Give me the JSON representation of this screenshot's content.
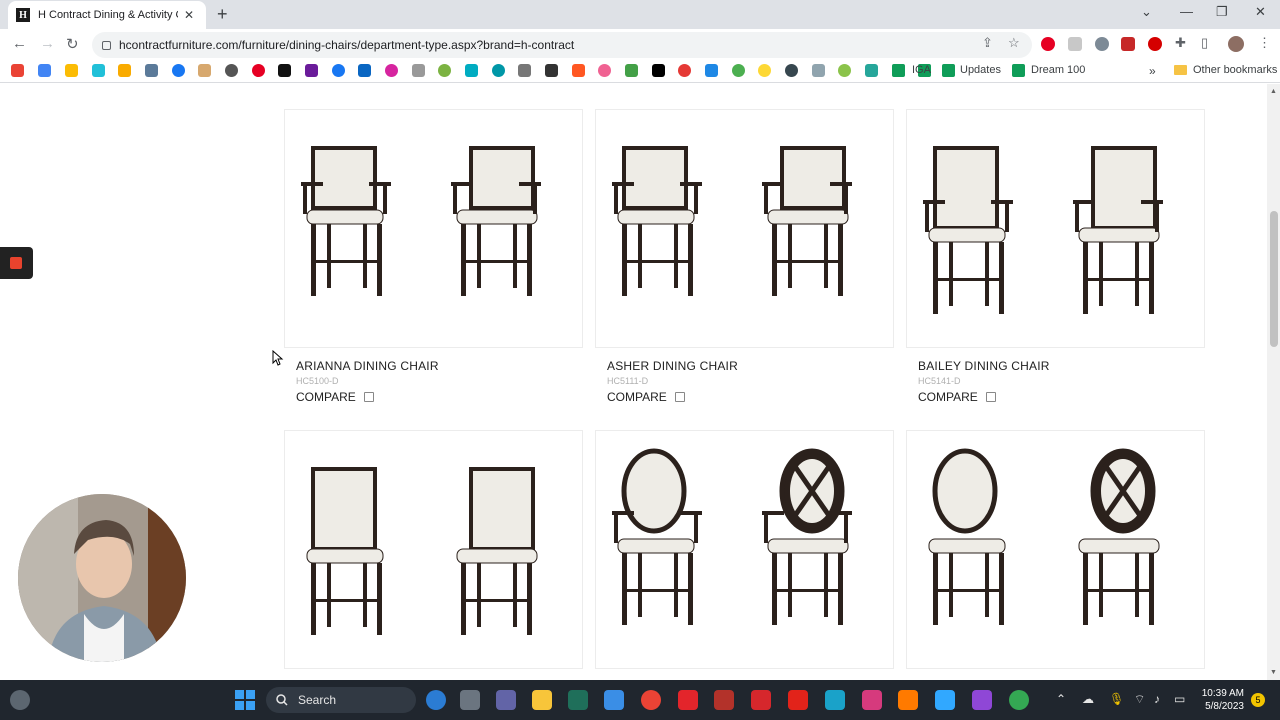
{
  "browser": {
    "tab_title": "H Contract Dining & Activity Cha",
    "tab_favicon_letter": "H",
    "url": "hcontractfurniture.com/furniture/dining-chairs/department-type.aspx?brand=h-contract",
    "bookmarks": {
      "iga": "IGA",
      "updates": "Updates",
      "dream100": "Dream 100",
      "other": "Other bookmarks"
    }
  },
  "products": [
    {
      "name": "ARIANNA DINING CHAIR",
      "sku": "HC5100-D",
      "compare_label": "COMPARE",
      "style": "upholstered-arm"
    },
    {
      "name": "ASHER DINING CHAIR",
      "sku": "HC5111-D",
      "compare_label": "COMPARE",
      "style": "upholstered-arm"
    },
    {
      "name": "BAILEY DINING CHAIR",
      "sku": "HC5141-D",
      "compare_label": "COMPARE",
      "style": "tall-arm"
    },
    {
      "style": "armless-tall"
    },
    {
      "style": "oval-x-arm"
    },
    {
      "style": "oval-x-side"
    }
  ],
  "colors": {
    "wood": "#2b211c",
    "fabric": "#eeece6",
    "accent_red": "#e8432d"
  },
  "taskbar": {
    "search_label": "Search",
    "time": "10:39 AM",
    "date": "5/8/2023",
    "notification_count": "5"
  }
}
